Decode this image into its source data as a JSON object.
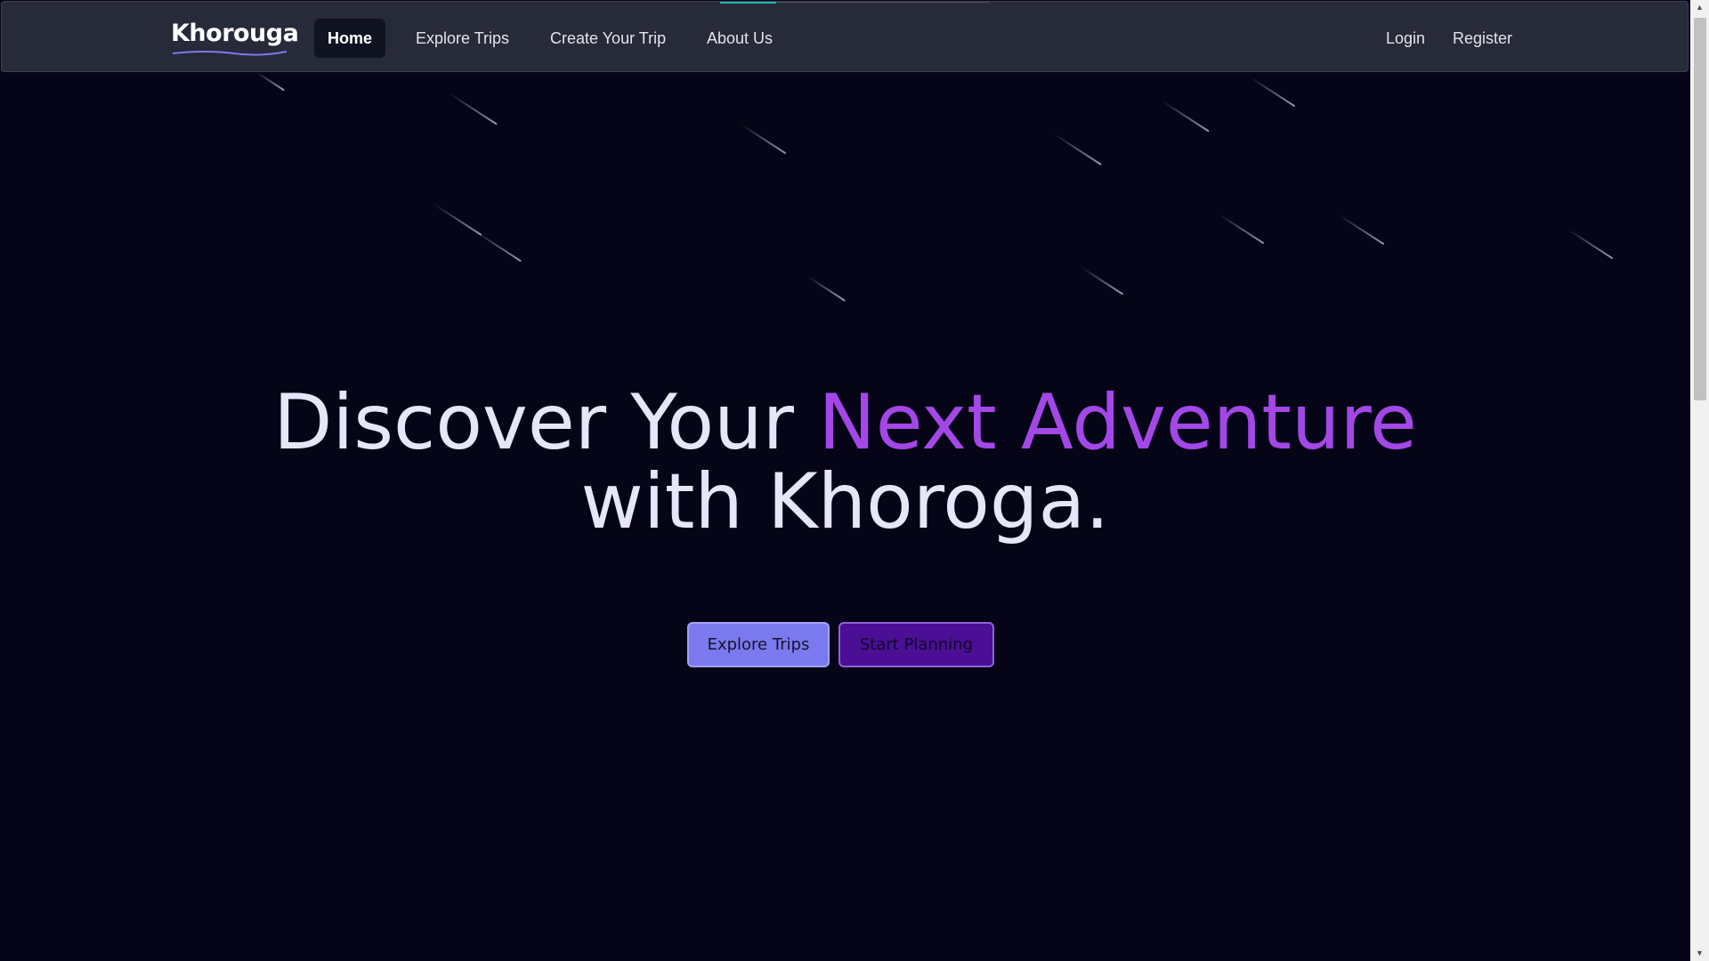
{
  "navbar": {
    "brand": "Khorouga",
    "links": [
      {
        "label": "Home",
        "active": true
      },
      {
        "label": "Explore Trips",
        "active": false
      },
      {
        "label": "Create Your Trip",
        "active": false
      },
      {
        "label": "About Us",
        "active": false
      }
    ],
    "auth": {
      "login": "Login",
      "register": "Register"
    }
  },
  "hero": {
    "line1_plain": "Discover Your ",
    "line1_highlight": "Next Adventure",
    "line2": "with Khoroga.",
    "buttons": {
      "explore": "Explore Trips",
      "plan": "Start Planning"
    }
  },
  "scrollbar": {
    "up_icon": "▲",
    "down_icon": "▼"
  },
  "colors": {
    "background": "#050517",
    "navbar": "#272a38",
    "highlight": "#a347e6",
    "explore_button": "#7b79ee",
    "plan_button": "#4a0f94"
  }
}
